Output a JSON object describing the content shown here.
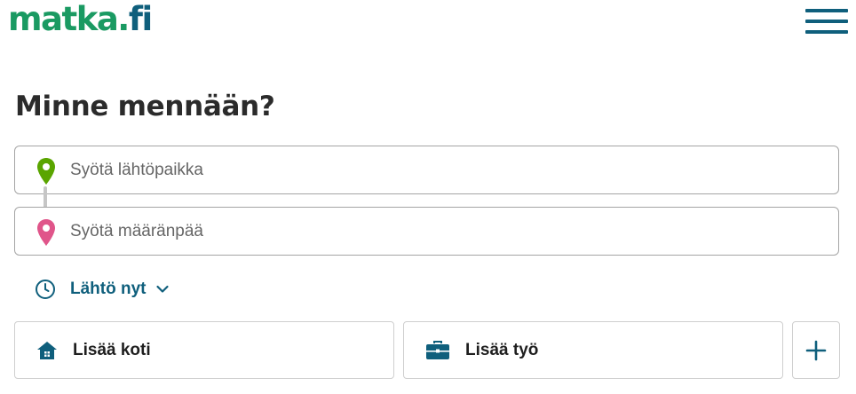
{
  "header": {
    "logo_part1": "matka",
    "logo_dot": ".",
    "logo_part2": "fi",
    "menu_icon": "hamburger-menu-icon"
  },
  "page_title": "Minne mennään?",
  "origin": {
    "placeholder": "Syötä lähtöpaikka",
    "value": "",
    "icon": "map-pin-green-icon",
    "color": "#5aa500"
  },
  "destination": {
    "placeholder": "Syötä määränpää",
    "value": "",
    "icon": "map-pin-pink-icon",
    "color": "#e0558a"
  },
  "time_selector": {
    "label": "Lähtö nyt",
    "icon": "clock-icon"
  },
  "quick_places": [
    {
      "label": "Lisää koti",
      "icon": "home-icon"
    },
    {
      "label": "Lisää työ",
      "icon": "briefcase-icon"
    }
  ],
  "add_place": {
    "icon": "plus-icon"
  },
  "colors": {
    "brand_green": "#1a9a62",
    "brand_teal": "#0f5f7c",
    "title": "#2b2b2b"
  }
}
